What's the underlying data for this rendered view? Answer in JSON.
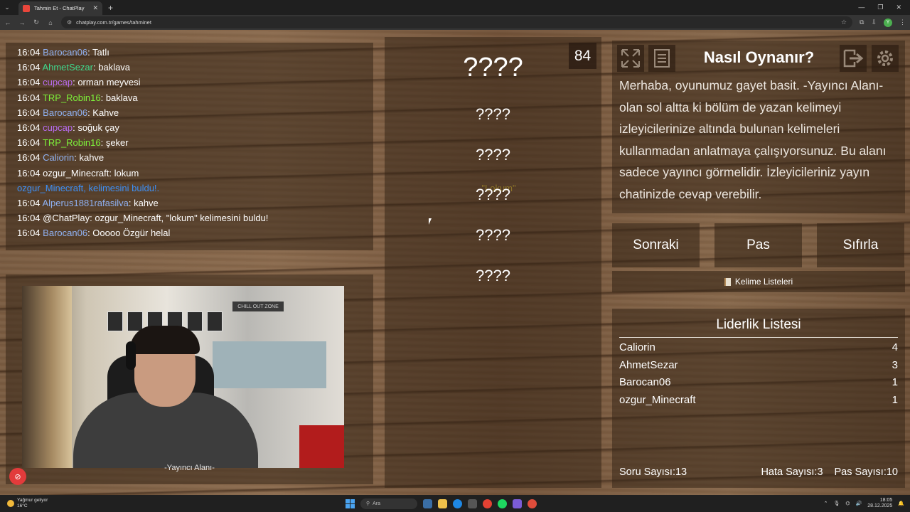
{
  "browser": {
    "tab_title": "Tahmin Et - ChatPlay",
    "url": "chatplay.com.tr/games/tahminet",
    "profile_initial": "Y"
  },
  "chat": {
    "messages": [
      {
        "time": "16:04",
        "user": "Barocan06",
        "color": "#8fb0f0",
        "text": ": Tatlı"
      },
      {
        "time": "16:04",
        "user": "AhmetSezar",
        "color": "#3fd88d",
        "text": ": baklava"
      },
      {
        "time": "16:04",
        "user": "cupcap",
        "color": "#b96cf2",
        "text": ": orman meyvesi"
      },
      {
        "time": "16:04",
        "user": "TRP_Robin16",
        "color": "#7ef23a",
        "text": ": baklava"
      },
      {
        "time": "16:04",
        "user": "Barocan06",
        "color": "#8fb0f0",
        "text": ": Kahve"
      },
      {
        "time": "16:04",
        "user": "cupcap",
        "color": "#b96cf2",
        "text": ": soğuk çay"
      },
      {
        "time": "16:04",
        "user": "TRP_Robin16",
        "color": "#7ef23a",
        "text": ": şeker"
      },
      {
        "time": "16:04",
        "user": "Caliorin",
        "color": "#8fb0f0",
        "text": ": kahve"
      },
      {
        "time": "16:04",
        "user": "ozgur_Minecraft",
        "color": "#ffffff",
        "text": ": lokum"
      }
    ],
    "system_message": {
      "prefix": "ozgur_Minecraft, ",
      "word": "\"Lokum\"",
      "suffix": " kelimesini buldu!."
    },
    "messages_after": [
      {
        "time": "16:04",
        "user": "Alperus1881rafasilva",
        "color": "#8fb0f0",
        "text": ": kahve"
      },
      {
        "time": "16:04",
        "user": "@ChatPlay",
        "color": "#ffffff",
        "text": ": ozgur_Minecraft, \"lokum\" kelimesini buldu!"
      },
      {
        "time": "16:04",
        "user": "Barocan06",
        "color": "#8fb0f0",
        "text": ": Ooooo Özgür helal"
      }
    ]
  },
  "webcam": {
    "label": "-Yayıncı Alanı-",
    "sign": "CHILL OUT ZONE"
  },
  "game": {
    "counter": "84",
    "main_word": "????",
    "hidden_words": [
      "????",
      "????",
      "????",
      "????",
      "????"
    ]
  },
  "info": {
    "title": "Nasıl Oynanır?",
    "text": "Merhaba, oyunumuz gayet basit. -Yayıncı Alanı- olan sol altta ki bölüm de yazan kelimeyi izleyicilerinize altında bulunan kelimeleri kullanmadan anlatmaya çalışıyorsunuz. Bu alanı sadece yayıncı görmelidir. İzleyicileriniz yayın chatinizde cevap verebilir."
  },
  "buttons": {
    "next": "Sonraki",
    "pass": "Pas",
    "reset": "Sıfırla",
    "word_lists": "Kelime Listeleri"
  },
  "leaderboard": {
    "title": "Liderlik Listesi",
    "rows": [
      {
        "name": "Caliorin",
        "score": "4"
      },
      {
        "name": "AhmetSezar",
        "score": "3"
      },
      {
        "name": "Barocan06",
        "score": "1"
      },
      {
        "name": "ozgur_Minecraft",
        "score": "1"
      }
    ]
  },
  "stats": {
    "questions_label": "Soru Sayısı:",
    "questions": "13",
    "errors_label": "Hata Sayısı:",
    "errors": "3",
    "passes_label": "Pas Sayısı:",
    "passes": "10"
  },
  "taskbar": {
    "weather": "Yağmur geliyor",
    "weather_temp": "16°C",
    "search_placeholder": "Ara",
    "time": "18:05",
    "date": "28.12.2025"
  }
}
